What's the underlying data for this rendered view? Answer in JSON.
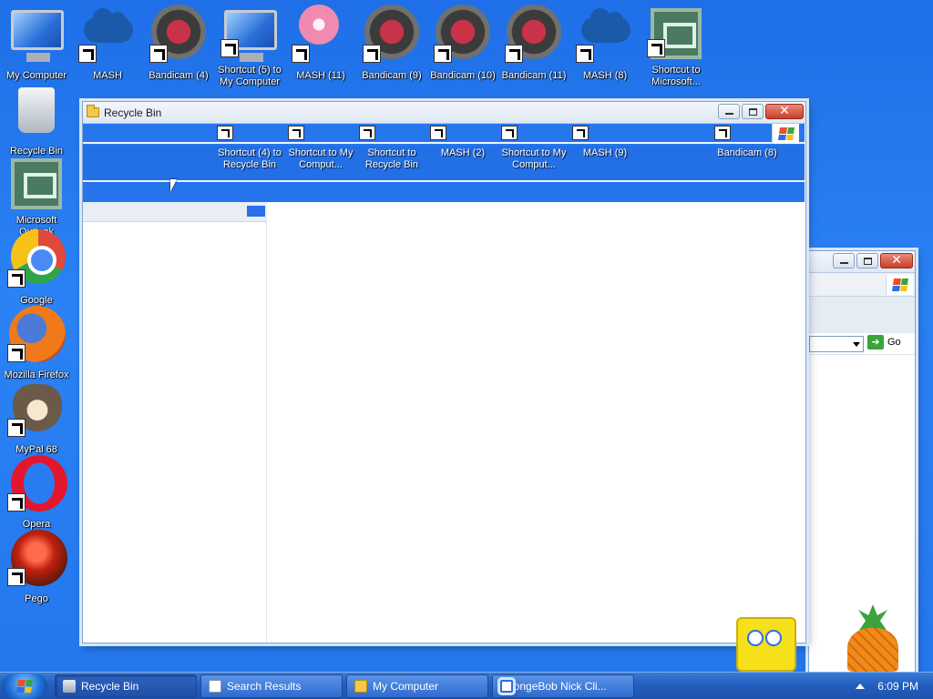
{
  "desktop": {
    "top_row": [
      {
        "id": "my-computer",
        "label": "My Computer",
        "art": "monitor",
        "shortcut": false
      },
      {
        "id": "mash",
        "label": "MASH",
        "art": "cloud",
        "shortcut": true
      },
      {
        "id": "bandicam-4",
        "label": "Bandicam (4)",
        "art": "bandicam",
        "shortcut": true
      },
      {
        "id": "shortcut-5-my-computer",
        "label": "Shortcut (5) to My Computer",
        "art": "monitor",
        "shortcut": true
      },
      {
        "id": "mash-11",
        "label": "MASH (11)",
        "art": "mash11",
        "shortcut": true
      },
      {
        "id": "bandicam-9",
        "label": "Bandicam (9)",
        "art": "bandicam",
        "shortcut": true
      },
      {
        "id": "bandicam-10",
        "label": "Bandicam (10)",
        "art": "bandicam",
        "shortcut": true
      },
      {
        "id": "bandicam-11",
        "label": "Bandicam (11)",
        "art": "bandicam",
        "shortcut": true
      },
      {
        "id": "mash-8",
        "label": "MASH (8)",
        "art": "cloud",
        "shortcut": true
      },
      {
        "id": "shortcut-microsoft",
        "label": "Shortcut to Microsoft...",
        "art": "outlook",
        "shortcut": true
      }
    ],
    "left_column": [
      {
        "id": "recycle-bin",
        "label": "Recycle Bin",
        "art": "recycle",
        "shortcut": false
      },
      {
        "id": "microsoft-outlook",
        "label": "Microsoft Outlook",
        "art": "outlook",
        "shortcut": false
      },
      {
        "id": "google",
        "label": "Google",
        "art": "chrome",
        "shortcut": true
      },
      {
        "id": "mozilla-firefox",
        "label": "Mozilla Firefox",
        "art": "firefox",
        "shortcut": true
      },
      {
        "id": "mypal-68",
        "label": "MyPal 68",
        "art": "raccoon",
        "shortcut": true
      },
      {
        "id": "opera",
        "label": "Opera",
        "art": "opera",
        "shortcut": true
      },
      {
        "id": "pego",
        "label": "Pego",
        "art": "pego",
        "shortcut": true
      }
    ]
  },
  "recycle_window": {
    "title": "Recycle Bin",
    "glitch_labels": [
      {
        "id": "shortcut-4-recycle-bin",
        "label": "Shortcut (4) to Recycle Bin"
      },
      {
        "id": "shortcut-my-computer",
        "label": "Shortcut to My Comput..."
      },
      {
        "id": "shortcut-recycle-bin",
        "label": "Shortcut to Recycle Bin"
      },
      {
        "id": "mash-2",
        "label": "MASH (2)"
      },
      {
        "id": "shortcut-my-computer-2",
        "label": "Shortcut to My Comput..."
      },
      {
        "id": "mash-9",
        "label": "MASH (9)"
      },
      {
        "id": "bandicam-8",
        "label": "Bandicam (8)"
      }
    ],
    "close_glyph": "✕"
  },
  "bg_window": {
    "go_label": "Go",
    "close_glyph": "✕"
  },
  "taskbar": {
    "items": [
      {
        "id": "recycle-bin",
        "label": "Recycle Bin",
        "icon": "recycle",
        "active": true
      },
      {
        "id": "search-results",
        "label": "Search Results",
        "icon": "search",
        "active": false
      },
      {
        "id": "my-computer",
        "label": "My Computer",
        "icon": "folder",
        "active": false
      },
      {
        "id": "spongebob",
        "label": "SpongeBob Nick Cli...",
        "icon": "window",
        "active": false
      }
    ],
    "clock": "6:09 PM"
  },
  "colors": {
    "desktop_blue": "#2a7bf0",
    "taskbar_blue": "#245fbf",
    "close_red": "#c8402a"
  }
}
